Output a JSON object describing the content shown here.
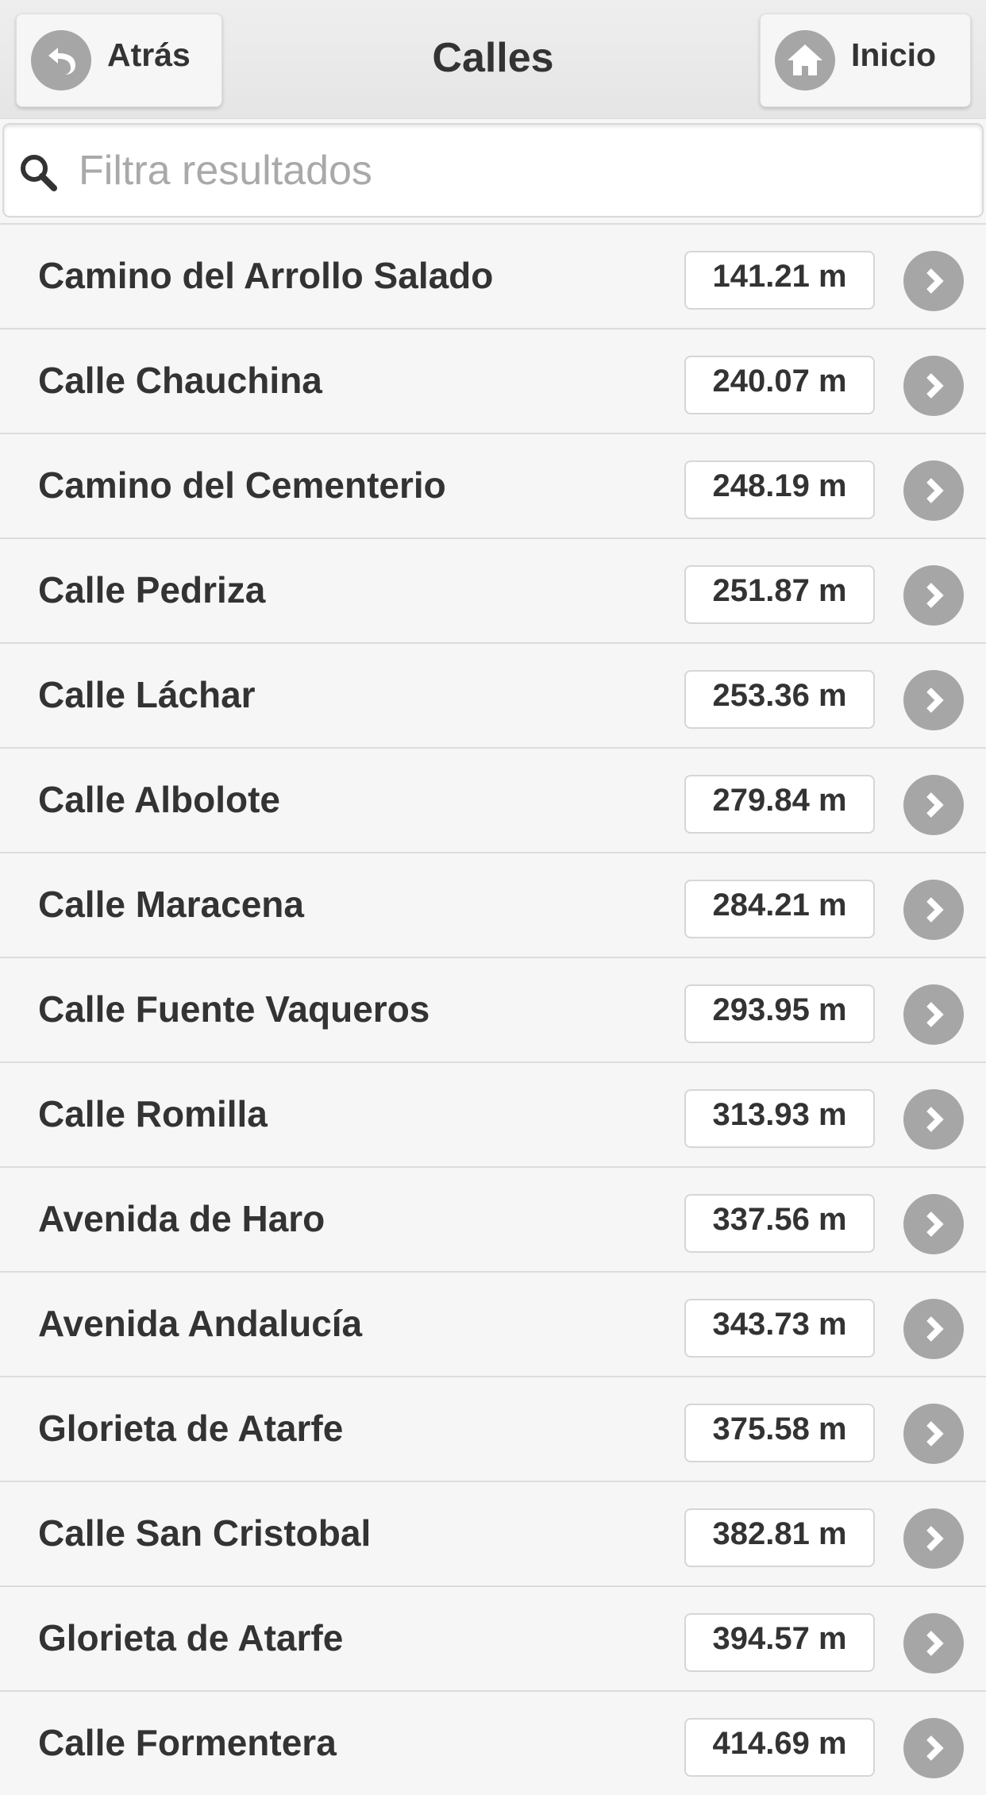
{
  "header": {
    "title": "Calles",
    "back_label": "Atrás",
    "home_label": "Inicio"
  },
  "search": {
    "placeholder": "Filtra resultados",
    "value": ""
  },
  "icons": {
    "back": "back-arrow-icon",
    "home": "home-icon",
    "search": "search-icon",
    "row_arrow": "chevron-right-icon"
  },
  "colors": {
    "background": "#f6f6f6",
    "header": "#e9e9e9",
    "icon_circle": "#a6a6a6",
    "text": "#333333",
    "placeholder": "#a9a9a9"
  },
  "streets": [
    {
      "name": "Camino del Arrollo Salado",
      "distance": "141.21 m"
    },
    {
      "name": "Calle Chauchina",
      "distance": "240.07 m"
    },
    {
      "name": "Camino del Cementerio",
      "distance": "248.19 m"
    },
    {
      "name": "Calle Pedriza",
      "distance": "251.87 m"
    },
    {
      "name": "Calle Láchar",
      "distance": "253.36 m"
    },
    {
      "name": "Calle Albolote",
      "distance": "279.84 m"
    },
    {
      "name": "Calle Maracena",
      "distance": "284.21 m"
    },
    {
      "name": "Calle Fuente Vaqueros",
      "distance": "293.95 m"
    },
    {
      "name": "Calle Romilla",
      "distance": "313.93 m"
    },
    {
      "name": "Avenida de Haro",
      "distance": "337.56 m"
    },
    {
      "name": "Avenida Andalucía",
      "distance": "343.73 m"
    },
    {
      "name": "Glorieta de Atarfe",
      "distance": "375.58 m"
    },
    {
      "name": "Calle San Cristobal",
      "distance": "382.81 m"
    },
    {
      "name": "Glorieta de Atarfe",
      "distance": "394.57 m"
    },
    {
      "name": "Calle Formentera",
      "distance": "414.69 m"
    }
  ]
}
